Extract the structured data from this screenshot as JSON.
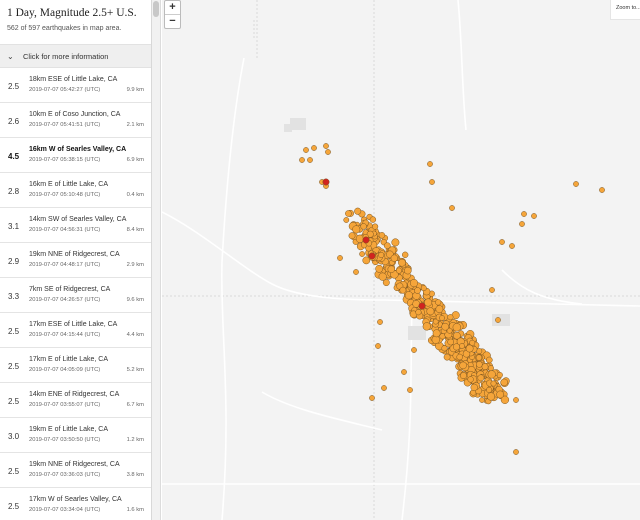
{
  "sidebar": {
    "title": "1 Day, Magnitude 2.5+ U.S.",
    "count_text": "562 of 597 earthquakes in map area.",
    "info_label": "Click for more information",
    "quakes": [
      {
        "mag": "2.5",
        "place": "18km ESE of Little Lake, CA",
        "time": "2019-07-07 05:42:27 (UTC)",
        "depth": "9.9 km"
      },
      {
        "mag": "2.6",
        "place": "10km E of Coso Junction, CA",
        "time": "2019-07-07 05:41:51 (UTC)",
        "depth": "2.1 km"
      },
      {
        "mag": "4.5",
        "place": "16km W of Searles Valley, CA",
        "time": "2019-07-07 05:38:15 (UTC)",
        "depth": "6.9 km"
      },
      {
        "mag": "2.8",
        "place": "16km E of Little Lake, CA",
        "time": "2019-07-07 05:10:48 (UTC)",
        "depth": "0.4 km"
      },
      {
        "mag": "3.1",
        "place": "14km SW of Searles Valley, CA",
        "time": "2019-07-07 04:56:31 (UTC)",
        "depth": "8.4 km"
      },
      {
        "mag": "2.9",
        "place": "19km NNE of Ridgecrest, CA",
        "time": "2019-07-07 04:48:17 (UTC)",
        "depth": "2.9 km"
      },
      {
        "mag": "3.3",
        "place": "7km SE of Ridgecrest, CA",
        "time": "2019-07-07 04:26:57 (UTC)",
        "depth": "9.6 km"
      },
      {
        "mag": "2.5",
        "place": "17km ESE of Little Lake, CA",
        "time": "2019-07-07 04:15:44 (UTC)",
        "depth": "4.4 km"
      },
      {
        "mag": "2.5",
        "place": "17km E of Little Lake, CA",
        "time": "2019-07-07 04:05:09 (UTC)",
        "depth": "5.2 km"
      },
      {
        "mag": "2.5",
        "place": "14km ENE of Ridgecrest, CA",
        "time": "2019-07-07 03:55:07 (UTC)",
        "depth": "6.7 km"
      },
      {
        "mag": "3.0",
        "place": "19km E of Little Lake, CA",
        "time": "2019-07-07 03:50:50 (UTC)",
        "depth": "1.2 km"
      },
      {
        "mag": "2.5",
        "place": "19km NNE of Ridgecrest, CA",
        "time": "2019-07-07 03:36:03 (UTC)",
        "depth": "3.8 km"
      },
      {
        "mag": "2.5",
        "place": "17km W of Searles Valley, CA",
        "time": "2019-07-07 03:34:04 (UTC)",
        "depth": "1.6 km"
      }
    ]
  },
  "map": {
    "zoom_in_label": "+",
    "zoom_out_label": "−",
    "zoom_to_label": "Zoom to...",
    "colors": {
      "background": "#f3f3f3",
      "road": "#ffffff",
      "boundary": "#cfcfcf",
      "urban": "#e2e2e2",
      "quake_fill": "#f5a53a",
      "quake_stroke": "#7a5420",
      "recent_fill": "#d1241f"
    }
  }
}
